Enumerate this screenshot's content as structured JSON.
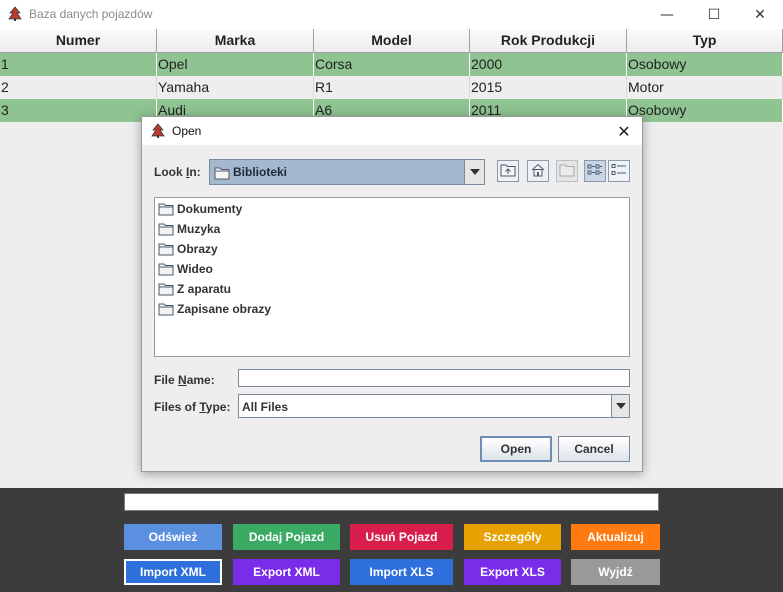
{
  "window": {
    "title": "Baza danych pojazdów",
    "controls": [
      "—",
      "☐",
      "✕"
    ]
  },
  "table": {
    "columns": [
      "Numer",
      "Marka",
      "Model",
      "Rok Produkcji",
      "Typ"
    ],
    "rows": [
      [
        "1",
        "Opel",
        "Corsa",
        "2000",
        "Osobowy"
      ],
      [
        "2",
        "Yamaha",
        "R1",
        "2015",
        "Motor"
      ],
      [
        "3",
        "Audi",
        "A6",
        "2011",
        "Osobowy"
      ]
    ],
    "highlight_color": "#8fc391"
  },
  "dialog": {
    "title": "Open",
    "close_glyph": "✕",
    "look_in_label_pre": "Look ",
    "look_in_label_u": "I",
    "look_in_label_post": "n:",
    "look_in_value": "Biblioteki",
    "toolbar_icons": [
      "up-one-level-icon",
      "home-icon",
      "new-folder-icon",
      "list-view-icon",
      "details-view-icon"
    ],
    "items": [
      "Dokumenty",
      "Muzyka",
      "Obrazy",
      "Wideo",
      "Z aparatu",
      "Zapisane obrazy"
    ],
    "file_name_label_pre": "File ",
    "file_name_label_u": "N",
    "file_name_label_post": "ame:",
    "file_name_value": "",
    "files_of_type_label_pre": "Files of ",
    "files_of_type_label_u": "T",
    "files_of_type_label_post": "ype:",
    "files_of_type_value": "All Files",
    "open_label": "Open",
    "cancel_label": "Cancel"
  },
  "actions": {
    "text_value": "",
    "row1": [
      {
        "label": "Odśwież",
        "color": "#5b8fe0"
      },
      {
        "label": "Dodaj Pojazd",
        "color": "#3aaa64"
      },
      {
        "label": "Usuń Pojazd",
        "color": "#d81e4a"
      },
      {
        "label": "Szczegóły",
        "color": "#e6a100"
      },
      {
        "label": "Aktualizuj",
        "color": "#ff7a10"
      }
    ],
    "row2": [
      {
        "label": "Import XML",
        "color": "#2d6fdc"
      },
      {
        "label": "Export XML",
        "color": "#7a2de8"
      },
      {
        "label": "Import XLS",
        "color": "#2d6fdc"
      },
      {
        "label": "Export XLS",
        "color": "#7a2de8"
      },
      {
        "label": "Wyjdź",
        "color": "#999999"
      }
    ]
  }
}
